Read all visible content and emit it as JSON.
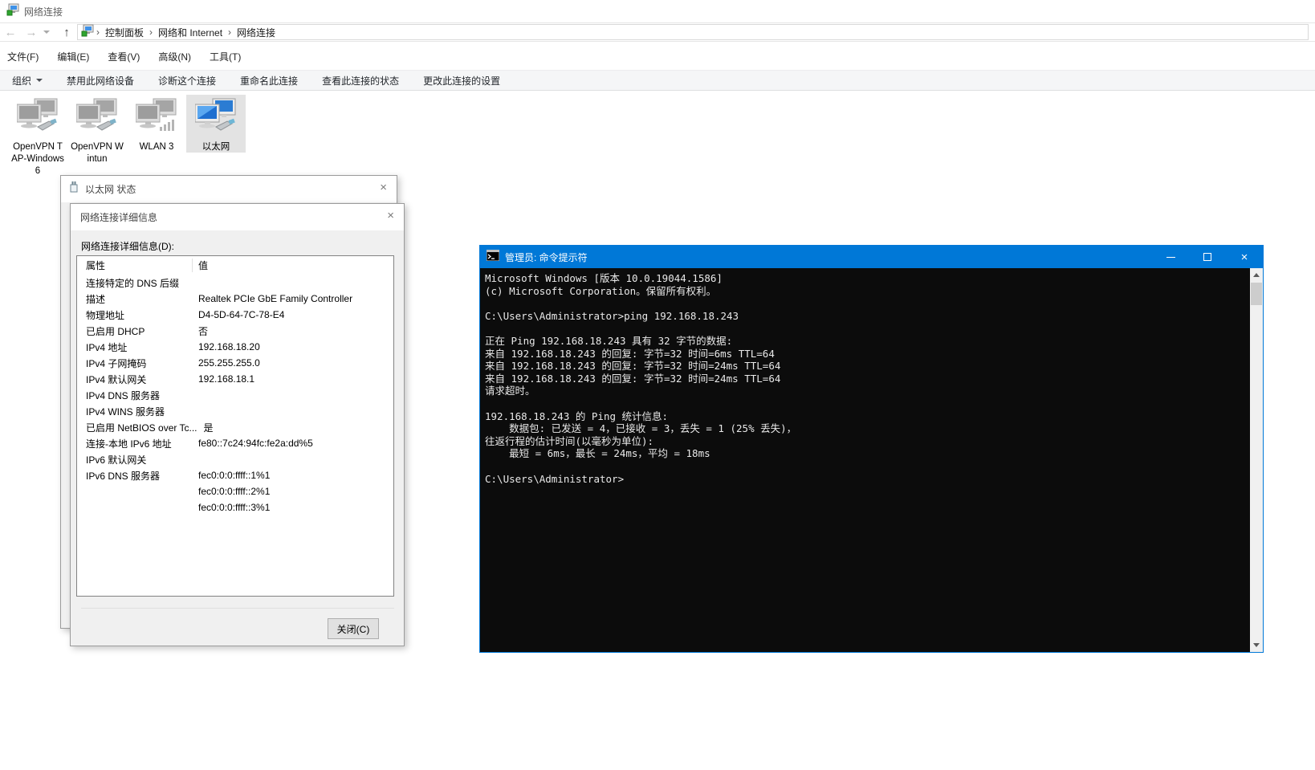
{
  "colors": {
    "accent_blue": "#0078d7",
    "terminal_bg": "#0c0c0c",
    "terminal_text": "#e9e9e9",
    "toolbar_bg": "#f5f6f7",
    "selection_bg": "#e3e3e3",
    "dialog_bg": "#f0f0f0"
  },
  "explorer": {
    "title": "网络连接",
    "nav": {
      "back_icon": "←",
      "forward_icon": "→",
      "up_icon": "↑"
    },
    "breadcrumb_sep": "›",
    "breadcrumb": [
      "控制面板",
      "网络和 Internet",
      "网络连接"
    ],
    "menu": [
      "文件(F)",
      "编辑(E)",
      "查看(V)",
      "高级(N)",
      "工具(T)"
    ],
    "toolbar": [
      "组织",
      "禁用此网络设备",
      "诊断这个连接",
      "重命名此连接",
      "查看此连接的状态",
      "更改此连接的设置"
    ],
    "adapters": [
      {
        "name": "OpenVPN TAP-Windows6",
        "state": "disabled"
      },
      {
        "name": "OpenVPN Wintun",
        "state": "disabled"
      },
      {
        "name": "WLAN 3",
        "state": "disabled"
      },
      {
        "name": "以太网",
        "state": "connected-selected"
      }
    ]
  },
  "status_dialog": {
    "title": "以太网 状态",
    "close_icon": "×"
  },
  "details_dialog": {
    "title": "网络连接详细信息",
    "close_icon": "×",
    "label": "网络连接详细信息(D):",
    "col_property": "属性",
    "col_value": "值",
    "rows": [
      {
        "p": "连接特定的 DNS 后缀",
        "v": ""
      },
      {
        "p": "描述",
        "v": "Realtek PCIe GbE Family Controller"
      },
      {
        "p": "物理地址",
        "v": "D4-5D-64-7C-78-E4"
      },
      {
        "p": "已启用 DHCP",
        "v": "否"
      },
      {
        "p": "IPv4 地址",
        "v": "192.168.18.20"
      },
      {
        "p": "IPv4 子网掩码",
        "v": "255.255.255.0"
      },
      {
        "p": "IPv4 默认网关",
        "v": "192.168.18.1"
      },
      {
        "p": "IPv4 DNS 服务器",
        "v": ""
      },
      {
        "p": "IPv4 WINS 服务器",
        "v": ""
      },
      {
        "p": "已启用 NetBIOS over Tc...",
        "v": "是"
      },
      {
        "p": "连接-本地 IPv6 地址",
        "v": "fe80::7c24:94fc:fe2a:dd%5"
      },
      {
        "p": "IPv6 默认网关",
        "v": ""
      },
      {
        "p": "IPv6 DNS 服务器",
        "v": "fec0:0:0:ffff::1%1"
      },
      {
        "p": "",
        "v": "fec0:0:0:ffff::2%1"
      },
      {
        "p": "",
        "v": "fec0:0:0:ffff::3%1"
      }
    ],
    "close_button": "关闭(C)"
  },
  "terminal": {
    "title": "管理员: 命令提示符",
    "close_icon": "×",
    "lines": [
      "Microsoft Windows [版本 10.0.19044.1586]",
      "(c) Microsoft Corporation。保留所有权利。",
      "",
      "C:\\Users\\Administrator>ping 192.168.18.243",
      "",
      "正在 Ping 192.168.18.243 具有 32 字节的数据:",
      "来自 192.168.18.243 的回复: 字节=32 时间=6ms TTL=64",
      "来自 192.168.18.243 的回复: 字节=32 时间=24ms TTL=64",
      "来自 192.168.18.243 的回复: 字节=32 时间=24ms TTL=64",
      "请求超时。",
      "",
      "192.168.18.243 的 Ping 统计信息:",
      "    数据包: 已发送 = 4，已接收 = 3，丢失 = 1 (25% 丢失)，",
      "往返行程的估计时间(以毫秒为单位):",
      "    最短 = 6ms，最长 = 24ms，平均 = 18ms",
      "",
      "C:\\Users\\Administrator>"
    ]
  }
}
